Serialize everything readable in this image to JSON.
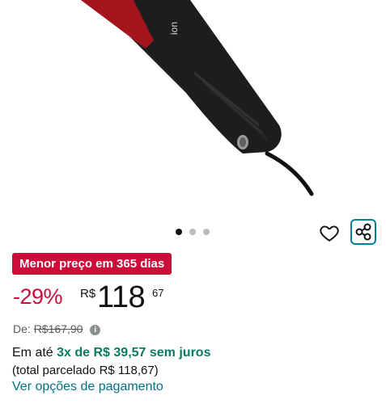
{
  "colors": {
    "badge_bg": "#cc0c39",
    "discount": "#cc0c39",
    "installment_highlight": "#067d62",
    "link": "#007185",
    "share_border": "#008296"
  },
  "product_image": {
    "brand_text": "ion",
    "alt": "hair straightener product photo"
  },
  "carousel": {
    "total": 3,
    "active_index": 0
  },
  "actions": {
    "wishlist_icon": "heart-icon",
    "share_icon": "share-icon"
  },
  "deal_badge": "Menor preço em 365 dias",
  "price": {
    "discount": "-29%",
    "currency": "R$",
    "whole": "118",
    "cents": "67"
  },
  "list_price": {
    "label": "De:",
    "value": "R$167,90",
    "info_icon": "i"
  },
  "installments": {
    "prefix": "Em até",
    "highlight": "3x de R$ 39,57 sem juros",
    "total": "(total parcelado R$ 118,67)"
  },
  "payment_link": "Ver opções de pagamento"
}
